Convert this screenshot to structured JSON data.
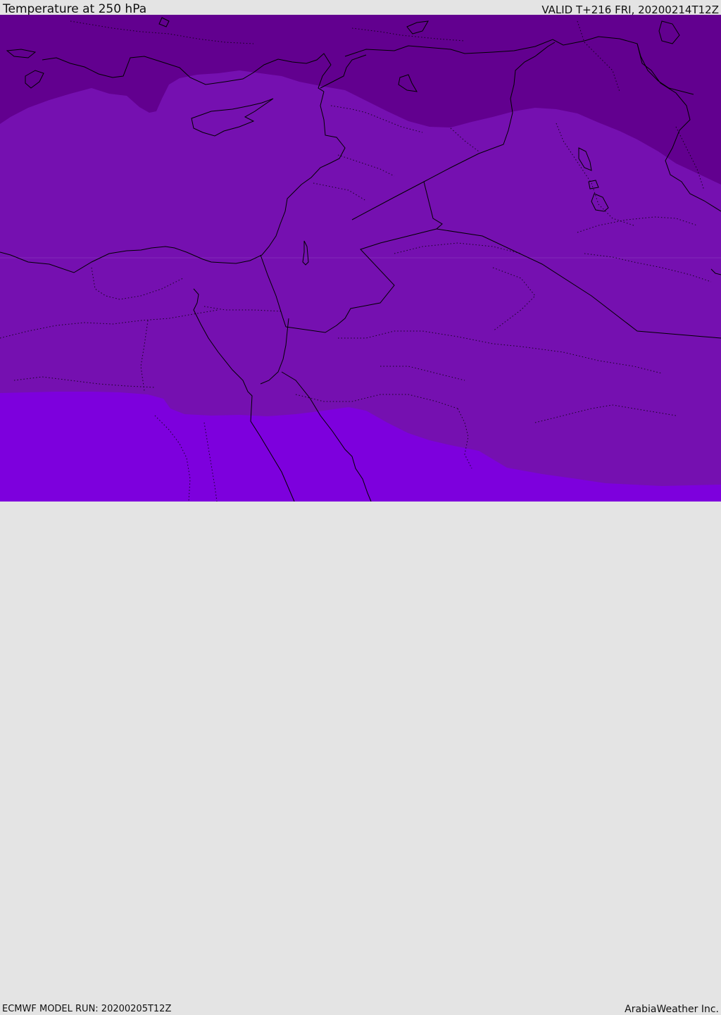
{
  "header": {
    "title": "Temperature at 250 hPa",
    "valid": "VALID T+216 FRI, 20200214T12Z"
  },
  "footer": {
    "model_run": "ECMWF MODEL RUN: 20200205T12Z",
    "credit": "ArabiaWeather Inc."
  },
  "colors": {
    "band_cold": "#62008f",
    "band_mid": "#7510b0",
    "band_warm": "#7d00dd",
    "border": "#000000"
  }
}
